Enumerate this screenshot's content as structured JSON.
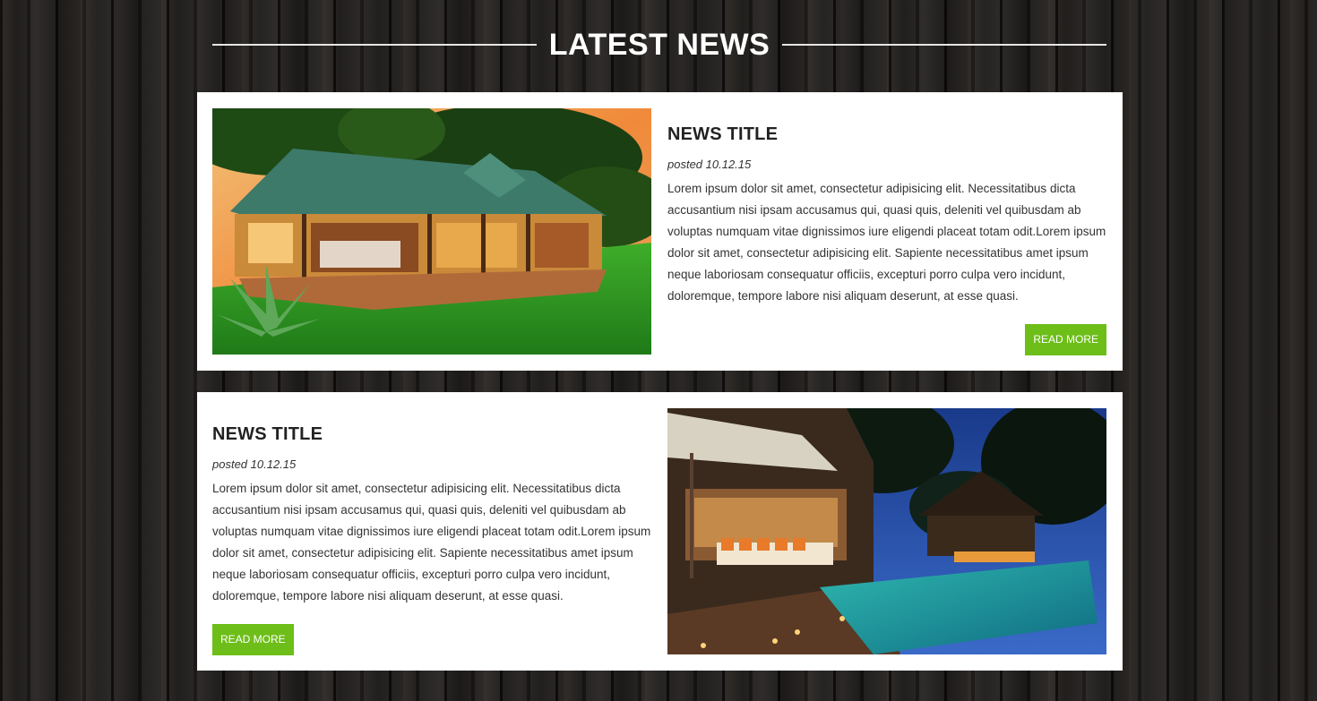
{
  "section": {
    "title": "LATEST NEWS"
  },
  "articles": [
    {
      "title": "NEWS TITLE",
      "posted": "posted 10.12.15",
      "body": "Lorem ipsum dolor sit amet, consectetur adipisicing elit. Necessitatibus dicta accusantium nisi ipsam accusamus qui, quasi quis, deleniti vel quibusdam ab voluptas numquam vitae dignissimos iure eligendi placeat totam odit.Lorem ipsum dolor sit amet, consectetur adipisicing elit. Sapiente necessitatibus amet ipsum neque laboriosam consequatur officiis, excepturi porro culpa vero incidunt, doloremque, tempore labore nisi aliquam deserunt, at esse quasi.",
      "button": "READ MORE",
      "image": "tropical-cottage-sunset-photo",
      "image_side": "left"
    },
    {
      "title": "NEWS TITLE",
      "posted": "posted 10.12.15",
      "body": "Lorem ipsum dolor sit amet, consectetur adipisicing elit. Necessitatibus dicta accusantium nisi ipsam accusamus qui, quasi quis, deleniti vel quibusdam ab voluptas numquam vitae dignissimos iure eligendi placeat totam odit.Lorem ipsum dolor sit amet, consectetur adipisicing elit. Sapiente necessitatibus amet ipsum neque laboriosam consequatur officiis, excepturi porro culpa vero incidunt, doloremque, tempore labore nisi aliquam deserunt, at esse quasi.",
      "button": "READ MORE",
      "image": "resort-pool-night-photo",
      "image_side": "right"
    }
  ],
  "colors": {
    "accent": "#6dbe18",
    "card_bg": "#ffffff",
    "heading_text": "#ffffff",
    "title_text": "#222222",
    "body_text": "#333333"
  }
}
